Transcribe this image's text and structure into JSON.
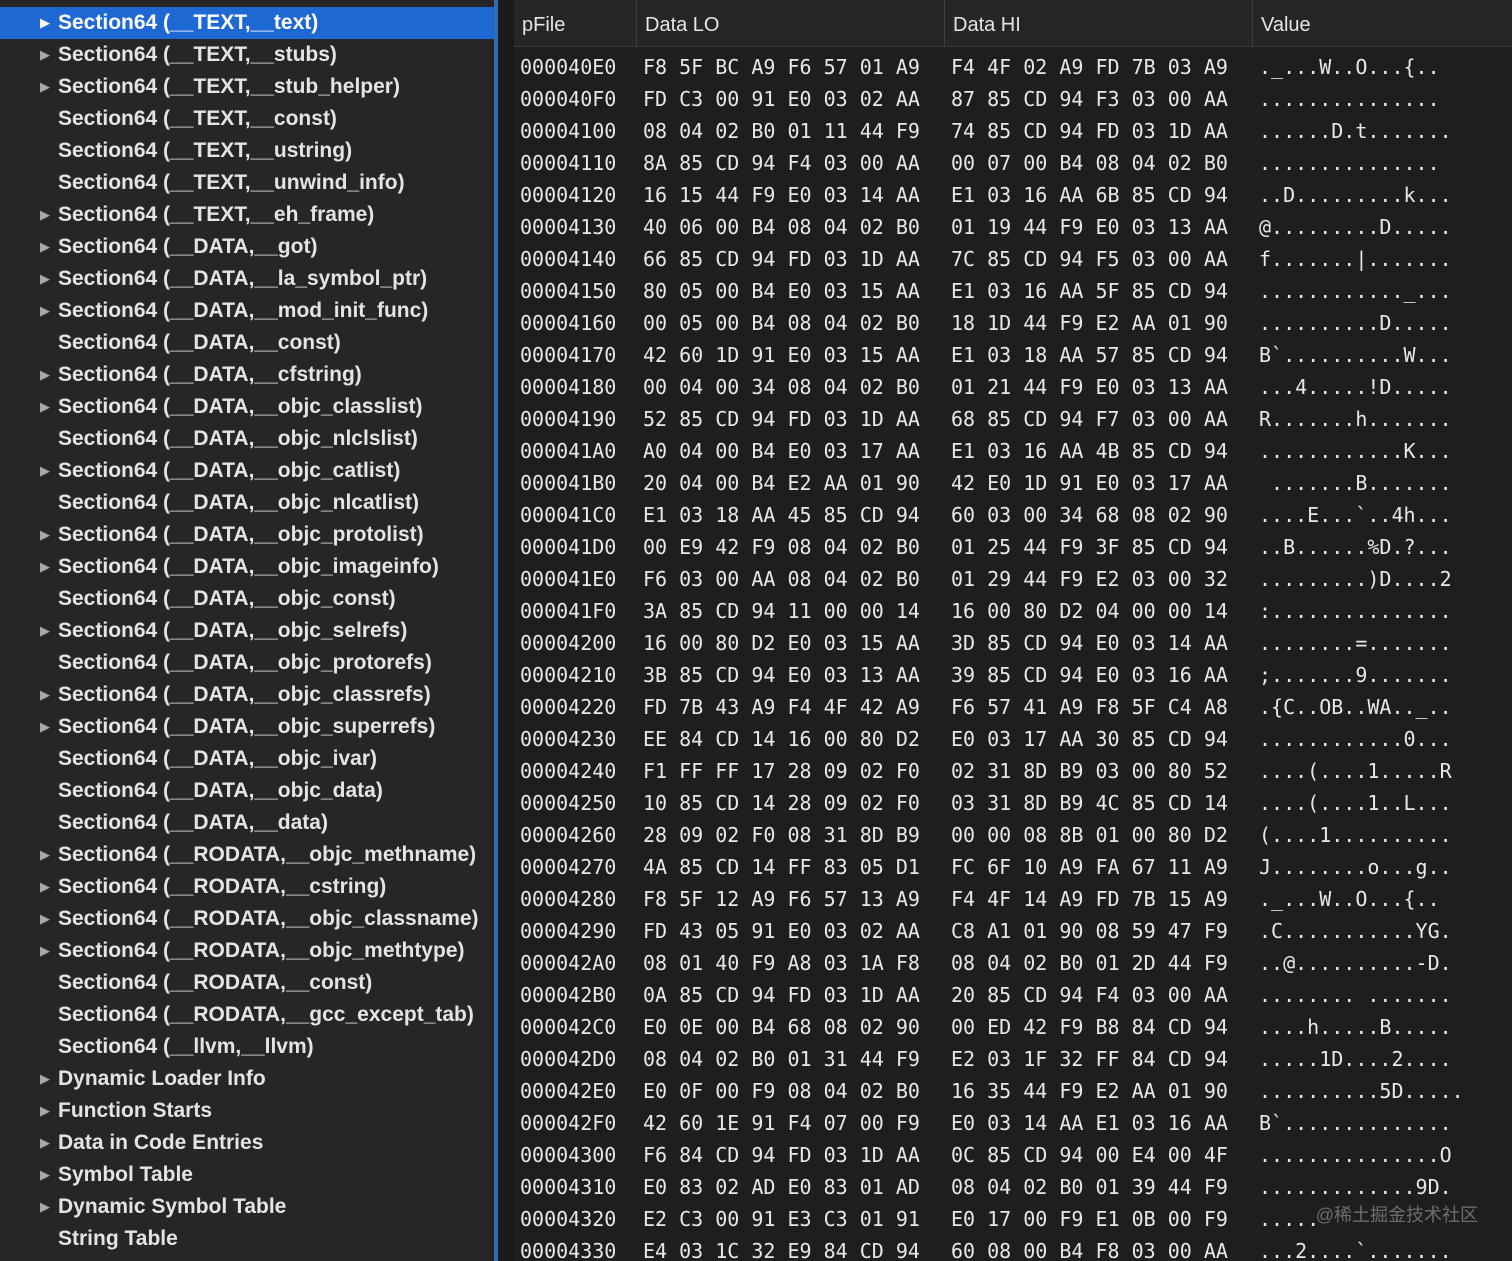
{
  "outline": {
    "items": [
      {
        "label": "Section64 (__TEXT,__text)",
        "expandable": true,
        "selected": true
      },
      {
        "label": "Section64 (__TEXT,__stubs)",
        "expandable": true
      },
      {
        "label": "Section64 (__TEXT,__stub_helper)",
        "expandable": true
      },
      {
        "label": "Section64 (__TEXT,__const)",
        "expandable": false
      },
      {
        "label": "Section64 (__TEXT,__ustring)",
        "expandable": false
      },
      {
        "label": "Section64 (__TEXT,__unwind_info)",
        "expandable": false
      },
      {
        "label": "Section64 (__TEXT,__eh_frame)",
        "expandable": true
      },
      {
        "label": "Section64 (__DATA,__got)",
        "expandable": true
      },
      {
        "label": "Section64 (__DATA,__la_symbol_ptr)",
        "expandable": true
      },
      {
        "label": "Section64 (__DATA,__mod_init_func)",
        "expandable": true
      },
      {
        "label": "Section64 (__DATA,__const)",
        "expandable": false
      },
      {
        "label": "Section64 (__DATA,__cfstring)",
        "expandable": true
      },
      {
        "label": "Section64 (__DATA,__objc_classlist)",
        "expandable": true
      },
      {
        "label": "Section64 (__DATA,__objc_nlclslist)",
        "expandable": false
      },
      {
        "label": "Section64 (__DATA,__objc_catlist)",
        "expandable": true
      },
      {
        "label": "Section64 (__DATA,__objc_nlcatlist)",
        "expandable": false
      },
      {
        "label": "Section64 (__DATA,__objc_protolist)",
        "expandable": true
      },
      {
        "label": "Section64 (__DATA,__objc_imageinfo)",
        "expandable": true
      },
      {
        "label": "Section64 (__DATA,__objc_const)",
        "expandable": false
      },
      {
        "label": "Section64 (__DATA,__objc_selrefs)",
        "expandable": true
      },
      {
        "label": "Section64 (__DATA,__objc_protorefs)",
        "expandable": false
      },
      {
        "label": "Section64 (__DATA,__objc_classrefs)",
        "expandable": true
      },
      {
        "label": "Section64 (__DATA,__objc_superrefs)",
        "expandable": true
      },
      {
        "label": "Section64 (__DATA,__objc_ivar)",
        "expandable": false
      },
      {
        "label": "Section64 (__DATA,__objc_data)",
        "expandable": false
      },
      {
        "label": "Section64 (__DATA,__data)",
        "expandable": false
      },
      {
        "label": "Section64 (__RODATA,__objc_methname)",
        "expandable": true
      },
      {
        "label": "Section64 (__RODATA,__cstring)",
        "expandable": true
      },
      {
        "label": "Section64 (__RODATA,__objc_classname)",
        "expandable": true
      },
      {
        "label": "Section64 (__RODATA,__objc_methtype)",
        "expandable": true
      },
      {
        "label": "Section64 (__RODATA,__const)",
        "expandable": false
      },
      {
        "label": "Section64 (__RODATA,__gcc_except_tab)",
        "expandable": false
      },
      {
        "label": "Section64 (__llvm,__llvm)",
        "expandable": false
      },
      {
        "label": "Dynamic Loader Info",
        "expandable": true
      },
      {
        "label": "Function Starts",
        "expandable": true
      },
      {
        "label": "Data in Code Entries",
        "expandable": true
      },
      {
        "label": "Symbol Table",
        "expandable": true
      },
      {
        "label": "Dynamic Symbol Table",
        "expandable": true
      },
      {
        "label": "String Table",
        "expandable": false
      }
    ]
  },
  "table": {
    "headers": {
      "pfile": "pFile",
      "data_lo": "Data LO",
      "data_hi": "Data HI",
      "value": "Value"
    },
    "rows": [
      {
        "pfile": "000040E0",
        "lo": "F8 5F BC A9 F6 57 01 A9",
        "hi": "F4 4F 02 A9 FD 7B 03 A9",
        "val": "._...W..O...{.."
      },
      {
        "pfile": "000040F0",
        "lo": "FD C3 00 91 E0 03 02 AA",
        "hi": "87 85 CD 94 F3 03 00 AA",
        "val": "..............."
      },
      {
        "pfile": "00004100",
        "lo": "08 04 02 B0 01 11 44 F9",
        "hi": "74 85 CD 94 FD 03 1D AA",
        "val": "......D.t......."
      },
      {
        "pfile": "00004110",
        "lo": "8A 85 CD 94 F4 03 00 AA",
        "hi": "00 07 00 B4 08 04 02 B0",
        "val": "..............."
      },
      {
        "pfile": "00004120",
        "lo": "16 15 44 F9 E0 03 14 AA",
        "hi": "E1 03 16 AA 6B 85 CD 94",
        "val": "..D.........k..."
      },
      {
        "pfile": "00004130",
        "lo": "40 06 00 B4 08 04 02 B0",
        "hi": "01 19 44 F9 E0 03 13 AA",
        "val": "@.........D....."
      },
      {
        "pfile": "00004140",
        "lo": "66 85 CD 94 FD 03 1D AA",
        "hi": "7C 85 CD 94 F5 03 00 AA",
        "val": "f.......|......."
      },
      {
        "pfile": "00004150",
        "lo": "80 05 00 B4 E0 03 15 AA",
        "hi": "E1 03 16 AA 5F 85 CD 94",
        "val": "............_..."
      },
      {
        "pfile": "00004160",
        "lo": "00 05 00 B4 08 04 02 B0",
        "hi": "18 1D 44 F9 E2 AA 01 90",
        "val": "..........D....."
      },
      {
        "pfile": "00004170",
        "lo": "42 60 1D 91 E0 03 15 AA",
        "hi": "E1 03 18 AA 57 85 CD 94",
        "val": "B`..........W..."
      },
      {
        "pfile": "00004180",
        "lo": "00 04 00 34 08 04 02 B0",
        "hi": "01 21 44 F9 E0 03 13 AA",
        "val": "...4.....!D....."
      },
      {
        "pfile": "00004190",
        "lo": "52 85 CD 94 FD 03 1D AA",
        "hi": "68 85 CD 94 F7 03 00 AA",
        "val": "R.......h......."
      },
      {
        "pfile": "000041A0",
        "lo": "A0 04 00 B4 E0 03 17 AA",
        "hi": "E1 03 16 AA 4B 85 CD 94",
        "val": "............K..."
      },
      {
        "pfile": "000041B0",
        "lo": "20 04 00 B4 E2 AA 01 90",
        "hi": "42 E0 1D 91 E0 03 17 AA",
        "val": " .......B......."
      },
      {
        "pfile": "000041C0",
        "lo": "E1 03 18 AA 45 85 CD 94",
        "hi": "60 03 00 34 68 08 02 90",
        "val": "....E...`..4h..."
      },
      {
        "pfile": "000041D0",
        "lo": "00 E9 42 F9 08 04 02 B0",
        "hi": "01 25 44 F9 3F 85 CD 94",
        "val": "..B......%D.?..."
      },
      {
        "pfile": "000041E0",
        "lo": "F6 03 00 AA 08 04 02 B0",
        "hi": "01 29 44 F9 E2 03 00 32",
        "val": ".........)D....2"
      },
      {
        "pfile": "000041F0",
        "lo": "3A 85 CD 94 11 00 00 14",
        "hi": "16 00 80 D2 04 00 00 14",
        "val": ":..............."
      },
      {
        "pfile": "00004200",
        "lo": "16 00 80 D2 E0 03 15 AA",
        "hi": "3D 85 CD 94 E0 03 14 AA",
        "val": "........=......."
      },
      {
        "pfile": "00004210",
        "lo": "3B 85 CD 94 E0 03 13 AA",
        "hi": "39 85 CD 94 E0 03 16 AA",
        "val": ";.......9......."
      },
      {
        "pfile": "00004220",
        "lo": "FD 7B 43 A9 F4 4F 42 A9",
        "hi": "F6 57 41 A9 F8 5F C4 A8",
        "val": ".{C..OB..WA.._.."
      },
      {
        "pfile": "00004230",
        "lo": "EE 84 CD 14 16 00 80 D2",
        "hi": "E0 03 17 AA 30 85 CD 94",
        "val": "............0..."
      },
      {
        "pfile": "00004240",
        "lo": "F1 FF FF 17 28 09 02 F0",
        "hi": "02 31 8D B9 03 00 80 52",
        "val": "....(....1.....R"
      },
      {
        "pfile": "00004250",
        "lo": "10 85 CD 14 28 09 02 F0",
        "hi": "03 31 8D B9 4C 85 CD 14",
        "val": "....(....1..L..."
      },
      {
        "pfile": "00004260",
        "lo": "28 09 02 F0 08 31 8D B9",
        "hi": "00 00 08 8B 01 00 80 D2",
        "val": "(....1.........."
      },
      {
        "pfile": "00004270",
        "lo": "4A 85 CD 14 FF 83 05 D1",
        "hi": "FC 6F 10 A9 FA 67 11 A9",
        "val": "J........o...g.."
      },
      {
        "pfile": "00004280",
        "lo": "F8 5F 12 A9 F6 57 13 A9",
        "hi": "F4 4F 14 A9 FD 7B 15 A9",
        "val": "._...W..O...{.."
      },
      {
        "pfile": "00004290",
        "lo": "FD 43 05 91 E0 03 02 AA",
        "hi": "C8 A1 01 90 08 59 47 F9",
        "val": ".C...........YG."
      },
      {
        "pfile": "000042A0",
        "lo": "08 01 40 F9 A8 03 1A F8",
        "hi": "08 04 02 B0 01 2D 44 F9",
        "val": "..@..........-D."
      },
      {
        "pfile": "000042B0",
        "lo": "0A 85 CD 94 FD 03 1D AA",
        "hi": "20 85 CD 94 F4 03 00 AA",
        "val": "........ ......."
      },
      {
        "pfile": "000042C0",
        "lo": "E0 0E 00 B4 68 08 02 90",
        "hi": "00 ED 42 F9 B8 84 CD 94",
        "val": "....h.....B....."
      },
      {
        "pfile": "000042D0",
        "lo": "08 04 02 B0 01 31 44 F9",
        "hi": "E2 03 1F 32 FF 84 CD 94",
        "val": ".....1D....2...."
      },
      {
        "pfile": "000042E0",
        "lo": "E0 0F 00 F9 08 04 02 B0",
        "hi": "16 35 44 F9 E2 AA 01 90",
        "val": "..........5D....."
      },
      {
        "pfile": "000042F0",
        "lo": "42 60 1E 91 F4 07 00 F9",
        "hi": "E0 03 14 AA E1 03 16 AA",
        "val": "B`.............."
      },
      {
        "pfile": "00004300",
        "lo": "F6 84 CD 94 FD 03 1D AA",
        "hi": "0C 85 CD 94 00 E4 00 4F",
        "val": "...............O"
      },
      {
        "pfile": "00004310",
        "lo": "E0 83 02 AD E0 83 01 AD",
        "hi": "08 04 02 B0 01 39 44 F9",
        "val": ".............9D."
      },
      {
        "pfile": "00004320",
        "lo": "E2 C3 00 91 E3 C3 01 91",
        "hi": "E0 17 00 F9 E1 0B 00 F9",
        "val": "....."
      },
      {
        "pfile": "00004330",
        "lo": "E4 03 1C 32 E9 84 CD 94",
        "hi": "60 08 00 B4 F8 03 00 AA",
        "val": "...2....`......."
      }
    ]
  },
  "watermark": "@稀土掘金技术社区"
}
